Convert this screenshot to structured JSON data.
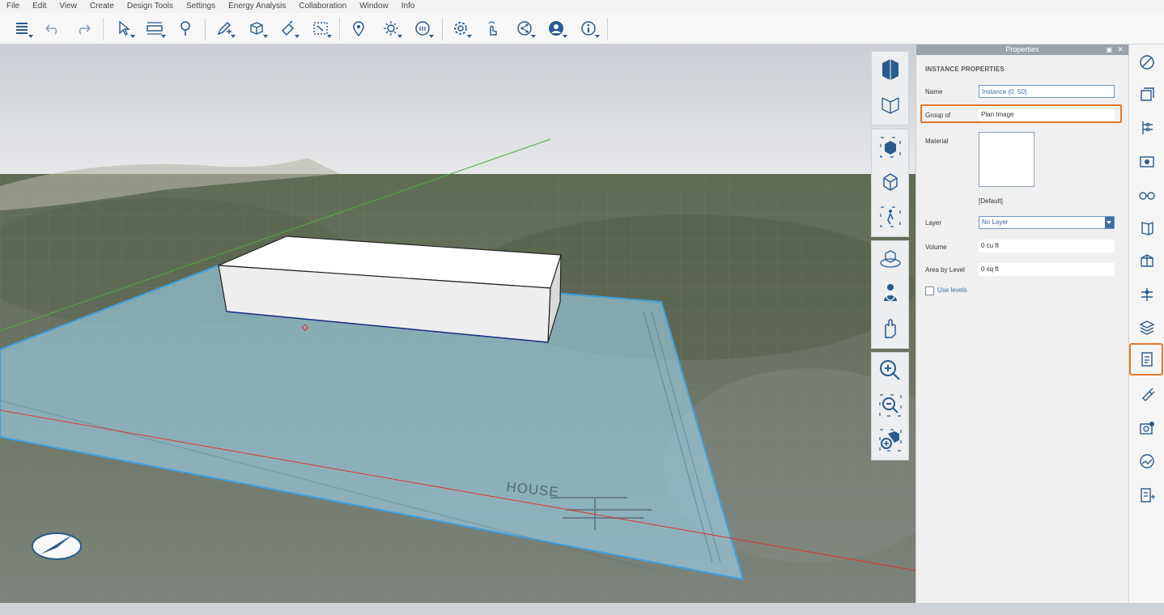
{
  "menu": [
    "File",
    "Edit",
    "View",
    "Create",
    "Design Tools",
    "Settings",
    "Energy Analysis",
    "Collaboration",
    "Window",
    "Info"
  ],
  "toolbar": {
    "icons": [
      "layers-menu-icon",
      "undo-icon",
      "redo-icon",
      "select-icon",
      "measure-icon",
      "tape-icon",
      "sketch-icon",
      "cube-push-icon",
      "material-paint-icon",
      "section-icon",
      "location-icon",
      "sun-icon",
      "time-icon",
      "settings-icon",
      "gesture-icon",
      "share-icon",
      "account-icon",
      "info-icon"
    ]
  },
  "viewport": {
    "image_label": "HOUSE",
    "tools": [
      "view-cube-icon",
      "view-cube-bottom-icon",
      "orbit-icon",
      "perspective-icon",
      "walk-icon",
      "look-around-icon",
      "pivot-icon",
      "pan-icon",
      "zoom-icon",
      "zoom-window-icon",
      "zoom-extents-icon"
    ]
  },
  "properties": {
    "title": "Properties",
    "section": "INSTANCE PROPERTIES",
    "name_label": "Name",
    "name_value": "Instance (0, 50)",
    "group_label": "Group of",
    "group_value": "Plan Image",
    "material_label": "Material",
    "material_value": "[Default]",
    "layer_label": "Layer",
    "layer_value": "No Layer",
    "volume_label": "Volume",
    "volume_value": "0 cu ft",
    "area_label": "Area by Level",
    "area_value": "0 sq ft",
    "levels_label": "Use levels"
  },
  "colors": {
    "accent_highlight": "#e2792a",
    "link_blue": "#3e6ea5",
    "plan_image_tint": "#9cd3ec",
    "green_axis": "#4caf3c",
    "red_axis": "#d9362f"
  }
}
